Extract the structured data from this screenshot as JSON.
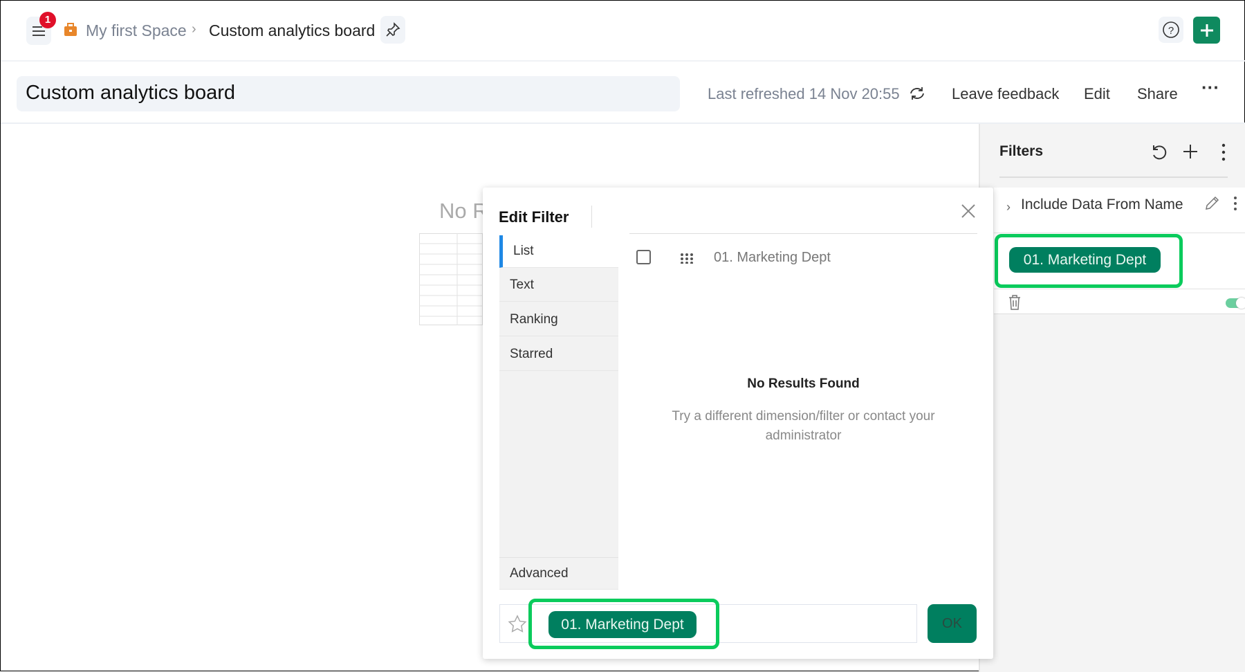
{
  "topbar": {
    "notification_count": "1",
    "breadcrumb_space": "My first Space",
    "breadcrumb_current": "Custom analytics board"
  },
  "header": {
    "title": "Custom analytics board",
    "last_refreshed": "Last refreshed 14 Nov 20:55",
    "leave_feedback": "Leave feedback",
    "edit": "Edit",
    "share": "Share"
  },
  "background": {
    "no_results_partial": "No R"
  },
  "filters_panel": {
    "title": "Filters",
    "filter_name": "Include Data From Name",
    "selected_chip": "01. Marketing Dept",
    "toggle_on": true
  },
  "edit_filter": {
    "title": "Edit Filter",
    "tabs": [
      "List",
      "Text",
      "Ranking",
      "Starred"
    ],
    "advanced": "Advanced",
    "list_item": "01. Marketing Dept",
    "no_results_title": "No Results Found",
    "no_results_msg_line1": "Try a different dimension/filter or contact your",
    "no_results_msg_line2": "administrator",
    "selected_chip": "01. Marketing Dept",
    "ok": "OK"
  },
  "colors": {
    "accent": "#007f5f",
    "highlight": "#0acb5c",
    "badge": "#e0102a"
  }
}
